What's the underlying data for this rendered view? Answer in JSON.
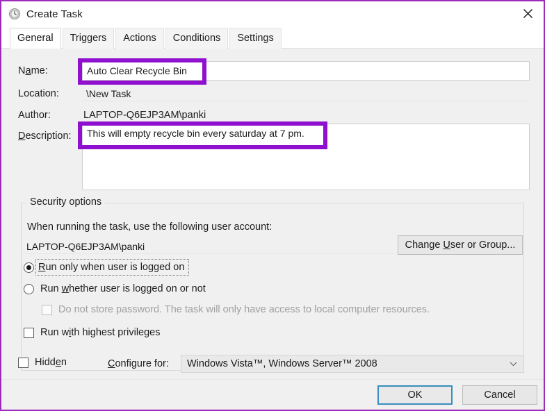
{
  "window": {
    "title": "Create Task",
    "icon": "clock-icon",
    "close_label": "Close"
  },
  "tabs": [
    {
      "label": "General",
      "active": true
    },
    {
      "label": "Triggers",
      "active": false
    },
    {
      "label": "Actions",
      "active": false
    },
    {
      "label": "Conditions",
      "active": false
    },
    {
      "label": "Settings",
      "active": false
    }
  ],
  "general": {
    "name_label": "Name:",
    "name_accel": "a",
    "name_value": "Auto Clear Recycle Bin",
    "location_label": "Location:",
    "location_value": "\\New Task",
    "author_label": "Author:",
    "author_value": "LAPTOP-Q6EJP3AM\\panki",
    "description_label": "Description:",
    "description_accel": "D",
    "description_value": "This will empty recycle bin every saturday at 7 pm."
  },
  "security": {
    "group_title": "Security options",
    "prompt": "When running the task, use the following user account:",
    "account_value": "LAPTOP-Q6EJP3AM\\panki",
    "change_button": "Change User or Group...",
    "change_button_accel": "U",
    "radio_logged_on": "Run only when user is logged on",
    "radio_logged_on_selected": true,
    "radio_whether": "Run whether user is logged on or not",
    "radio_whether_selected": false,
    "do_not_store_password": "Do not store password.  The task will only have access to local computer resources.",
    "do_not_store_password_checked": false,
    "do_not_store_password_disabled": true,
    "highest_privileges": "Run with highest privileges",
    "highest_privileges_checked": false
  },
  "bottom": {
    "hidden_label": "Hidden",
    "hidden_checked": false,
    "configure_label": "Configure for:",
    "configure_accel": "C",
    "configure_value": "Windows Vista™, Windows Server™ 2008",
    "dropdown_icon": "chevron-down-icon"
  },
  "footer": {
    "ok_label": "OK",
    "cancel_label": "Cancel"
  },
  "annotations": {
    "highlight_color": "#8f10cf",
    "window_border_color": "#9b2bb8",
    "default_button_border_color": "#3a8dbe"
  }
}
